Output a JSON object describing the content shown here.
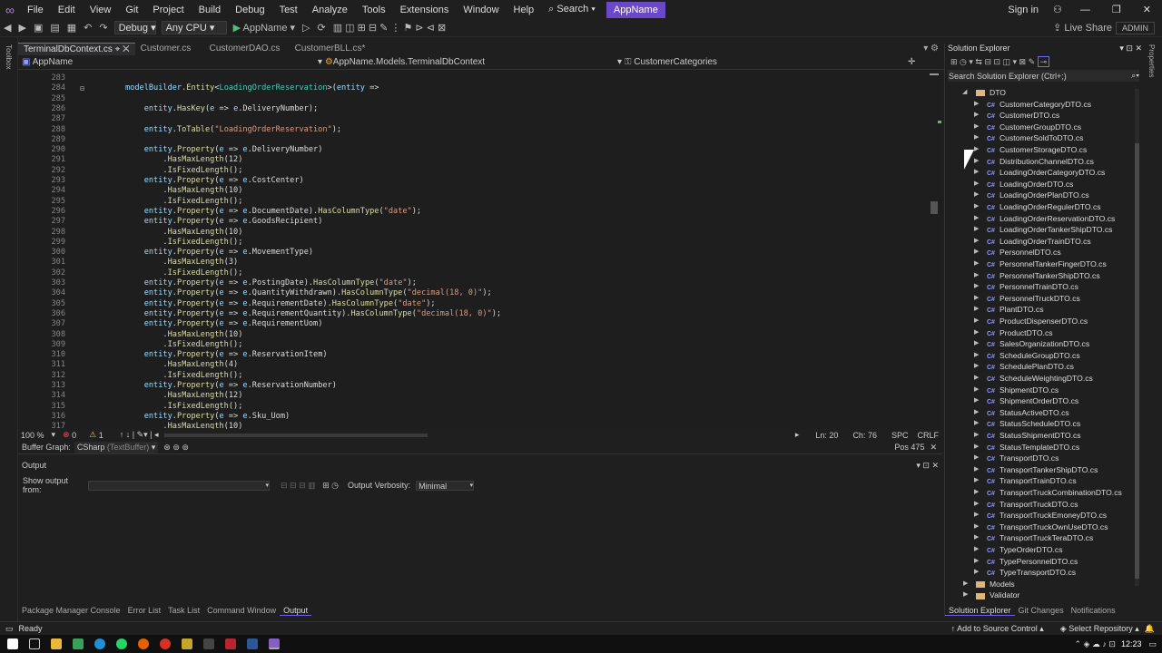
{
  "menu": [
    "File",
    "Edit",
    "View",
    "Git",
    "Project",
    "Build",
    "Debug",
    "Test",
    "Analyze",
    "Tools",
    "Extensions",
    "Window",
    "Help"
  ],
  "search": "Search",
  "appname": "AppName",
  "sign_in": "Sign in",
  "toolbar": {
    "config": "Debug",
    "platform": "Any CPU",
    "run": "AppName",
    "live_share": "Live Share",
    "admin": "ADMIN"
  },
  "tabs": [
    "TerminalDbContext.cs",
    "Customer.cs",
    "CustomerDAO.cs",
    "CustomerBLL.cs*"
  ],
  "nav": {
    "project": "AppName",
    "class": "AppName.Models.TerminalDbContext",
    "member": "CustomerCategories"
  },
  "code_lines": [
    {
      "n": "283",
      "c": ""
    },
    {
      "n": "284",
      "c": "modelBuilder.Entity<LoadingOrderReservation>(entity =>"
    },
    {
      "n": "285",
      "c": ""
    },
    {
      "n": "286",
      "c": "    entity.HasKey(e => e.DeliveryNumber);"
    },
    {
      "n": "287",
      "c": ""
    },
    {
      "n": "288",
      "c": "    entity.ToTable(\"LoadingOrderReservation\");"
    },
    {
      "n": "289",
      "c": ""
    },
    {
      "n": "290",
      "c": "    entity.Property(e => e.DeliveryNumber)"
    },
    {
      "n": "291",
      "c": "        .HasMaxLength(12)"
    },
    {
      "n": "292",
      "c": "        .IsFixedLength();"
    },
    {
      "n": "293",
      "c": "    entity.Property(e => e.CostCenter)"
    },
    {
      "n": "294",
      "c": "        .HasMaxLength(10)"
    },
    {
      "n": "295",
      "c": "        .IsFixedLength();"
    },
    {
      "n": "296",
      "c": "    entity.Property(e => e.DocumentDate).HasColumnType(\"date\");"
    },
    {
      "n": "297",
      "c": "    entity.Property(e => e.GoodsRecipient)"
    },
    {
      "n": "298",
      "c": "        .HasMaxLength(10)"
    },
    {
      "n": "299",
      "c": "        .IsFixedLength();"
    },
    {
      "n": "300",
      "c": "    entity.Property(e => e.MovementType)"
    },
    {
      "n": "301",
      "c": "        .HasMaxLength(3)"
    },
    {
      "n": "302",
      "c": "        .IsFixedLength();"
    },
    {
      "n": "303",
      "c": "    entity.Property(e => e.PostingDate).HasColumnType(\"date\");"
    },
    {
      "n": "304",
      "c": "    entity.Property(e => e.QuantityWithdrawn).HasColumnType(\"decimal(18, 0)\");"
    },
    {
      "n": "305",
      "c": "    entity.Property(e => e.RequirementDate).HasColumnType(\"date\");"
    },
    {
      "n": "306",
      "c": "    entity.Property(e => e.RequirementQuantity).HasColumnType(\"decimal(18, 0)\");"
    },
    {
      "n": "307",
      "c": "    entity.Property(e => e.RequirementUom)"
    },
    {
      "n": "308",
      "c": "        .HasMaxLength(10)"
    },
    {
      "n": "309",
      "c": "        .IsFixedLength();"
    },
    {
      "n": "310",
      "c": "    entity.Property(e => e.ReservationItem)"
    },
    {
      "n": "311",
      "c": "        .HasMaxLength(4)"
    },
    {
      "n": "312",
      "c": "        .IsFixedLength();"
    },
    {
      "n": "313",
      "c": "    entity.Property(e => e.ReservationNumber)"
    },
    {
      "n": "314",
      "c": "        .HasMaxLength(12)"
    },
    {
      "n": "315",
      "c": "        .IsFixedLength();"
    },
    {
      "n": "316",
      "c": "    entity.Property(e => e.Sku_Uom)"
    },
    {
      "n": "317",
      "c": "        .HasMaxLength(10)"
    }
  ],
  "editor_status": {
    "zoom": "100 %",
    "errors": "0",
    "warnings": "1",
    "ln": "Ln: 20",
    "ch": "Ch: 76",
    "spc": "SPC",
    "crlf": "CRLF"
  },
  "buffer": {
    "label": "Buffer Graph:",
    "value": "CSharp",
    "sub": "(TextBuffer)",
    "pos": "Pos 475"
  },
  "output": {
    "title": "Output",
    "show_from": "Show output from:",
    "verbosity_label": "Output Verbosity:",
    "verbosity": "Minimal"
  },
  "bottom_tabs": [
    "Package Manager Console",
    "Error List",
    "Task List",
    "Command Window",
    "Output"
  ],
  "solution": {
    "title": "Solution Explorer",
    "search": "Search Solution Explorer (Ctrl+;)",
    "folder": "DTO",
    "files": [
      "CustomerCategoryDTO.cs",
      "CustomerDTO.cs",
      "CustomerGroupDTO.cs",
      "CustomerSoldToDTO.cs",
      "CustomerStorageDTO.cs",
      "DistributionChannelDTO.cs",
      "LoadingOrderCategoryDTO.cs",
      "LoadingOrderDTO.cs",
      "LoadingOrderPlanDTO.cs",
      "LoadingOrderRegulerDTO.cs",
      "LoadingOrderReservationDTO.cs",
      "LoadingOrderTankerShipDTO.cs",
      "LoadingOrderTrainDTO.cs",
      "PersonnelDTO.cs",
      "PersonnelTankerFingerDTO.cs",
      "PersonnelTankerShipDTO.cs",
      "PersonnelTrainDTO.cs",
      "PersonnelTruckDTO.cs",
      "PlantDTO.cs",
      "ProductDispenserDTO.cs",
      "ProductDTO.cs",
      "SalesOrganizationDTO.cs",
      "ScheduleGroupDTO.cs",
      "SchedulePlanDTO.cs",
      "ScheduleWeightingDTO.cs",
      "ShipmentDTO.cs",
      "ShipmentOrderDTO.cs",
      "StatusActiveDTO.cs",
      "StatusScheduleDTO.cs",
      "StatusShipmentDTO.cs",
      "StatusTemplateDTO.cs",
      "TransportDTO.cs",
      "TransportTankerShipDTO.cs",
      "TransportTrainDTO.cs",
      "TransportTruckCombinationDTO.cs",
      "TransportTruckDTO.cs",
      "TransportTruckEmoneyDTO.cs",
      "TransportTruckOwnUseDTO.cs",
      "TransportTruckTeraDTO.cs",
      "TypeOrderDTO.cs",
      "TypePersonnelDTO.cs",
      "TypeTransportDTO.cs"
    ],
    "folders_after": [
      "Models",
      "Validator"
    ],
    "tabs": [
      "Solution Explorer",
      "Git Changes",
      "Notifications"
    ]
  },
  "status": {
    "ready": "Ready",
    "source_control": "Add to Source Control",
    "repo": "Select Repository"
  },
  "clock": "12:23",
  "colors": {
    "accent": "#7160e8",
    "bg": "#1f1f1f",
    "editor": "#1e1e1e"
  }
}
